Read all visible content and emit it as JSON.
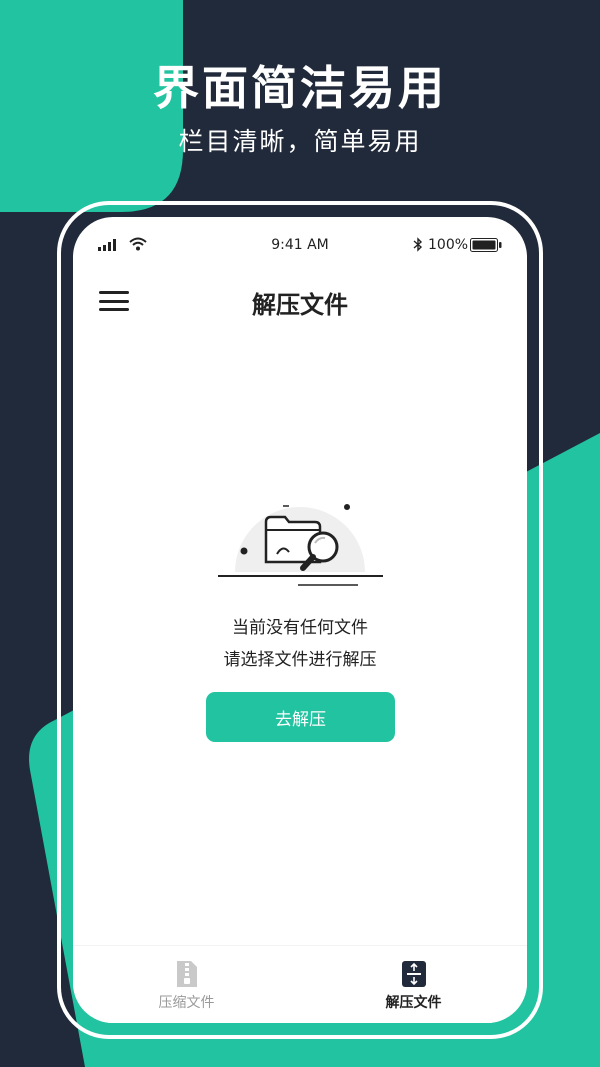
{
  "promo": {
    "headline": "界面简洁易用",
    "subheadline": "栏目清晰，简单易用"
  },
  "status_bar": {
    "time": "9:41 AM",
    "battery": "100%",
    "icons": [
      "signal-icon",
      "wifi-icon",
      "bluetooth-icon",
      "battery-icon"
    ]
  },
  "app_header": {
    "title": "解压文件",
    "menu_icon": "hamburger-menu-icon"
  },
  "empty_state": {
    "illustration": "empty-folder-search-icon",
    "line1": "当前没有任何文件",
    "line2": "请选择文件进行解压",
    "button_label": "去解压"
  },
  "tab_bar": {
    "tabs": [
      {
        "label": "压缩文件",
        "icon": "zip-file-icon",
        "active": false
      },
      {
        "label": "解压文件",
        "icon": "extract-icon",
        "active": true
      }
    ]
  },
  "colors": {
    "background": "#212a3a",
    "accent": "#22c3a0",
    "screen": "#ffffff",
    "text": "#222222",
    "inactive_text": "#9a9a9a"
  }
}
